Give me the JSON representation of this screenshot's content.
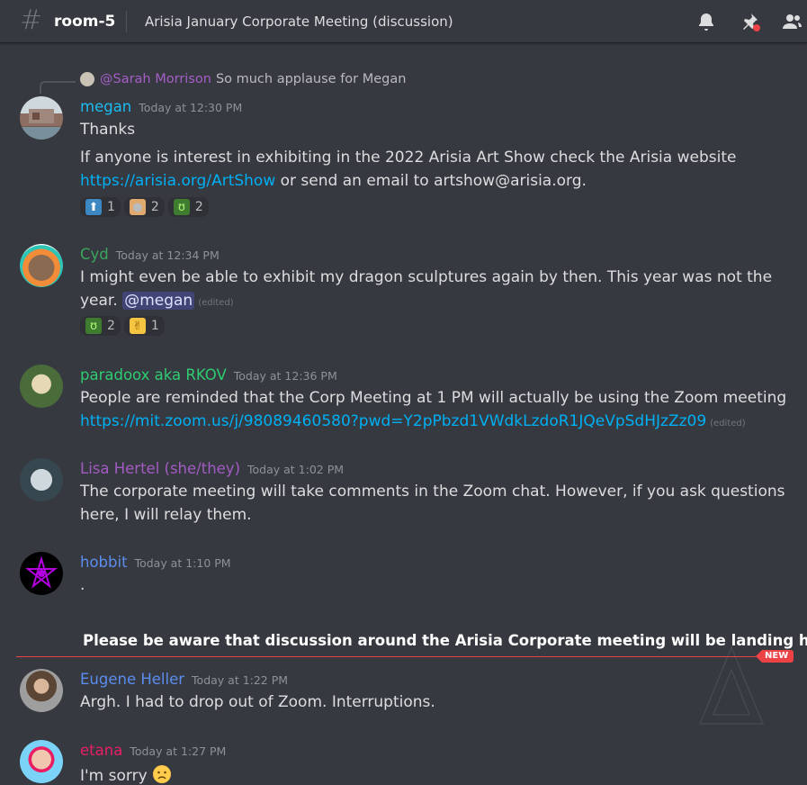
{
  "header": {
    "channel": "room-5",
    "topic": "Arisia January Corporate Meeting (discussion)",
    "icons": [
      "bell-icon",
      "pin-icon",
      "members-icon"
    ]
  },
  "reply": {
    "author": "@Sarah Morrison",
    "text": "So much applause for Megan"
  },
  "messages": [
    {
      "author": "megan",
      "color": "#1abcf0",
      "timestamp": "Today at 12:30 PM",
      "lines": [
        "Thanks",
        "If anyone is interest in exhibiting in the 2022 Arisia Art Show check the Arisia website"
      ],
      "link": "https://arisia.org/ArtShow",
      "after_link": " or send an email to artshow@arisia.org.",
      "reactions": [
        {
          "emoji": "⬆",
          "count": "1"
        },
        {
          "emoji": "🎨",
          "count": "2"
        },
        {
          "emoji": "🐉",
          "count": "2"
        }
      ]
    },
    {
      "author": "Cyd",
      "color": "#3ba55d",
      "timestamp": "Today at 12:34 PM",
      "lines": [
        "I might even be able to exhibit my dragon sculptures again by then.  This year was not the",
        "year."
      ],
      "mention": "@megan",
      "edited": "(edited)",
      "reactions": [
        {
          "emoji": "🐉",
          "count": "2"
        },
        {
          "emoji": "🤘",
          "count": "1"
        }
      ]
    },
    {
      "author": "paradoox aka RKOV",
      "color": "#2ecc71",
      "timestamp": "Today at 12:36 PM",
      "lines": [
        "People are reminded that the Corp Meeting at 1 PM will actually be using the Zoom meeting"
      ],
      "link": "https://mit.zoom.us/j/98089460580?pwd=Y2pPbzd1VWdkLzdoR1JQeVpSdHJzZz09",
      "edited": "(edited)"
    },
    {
      "author": "Lisa Hertel (she/they)",
      "color": "#a35bc4",
      "timestamp": "Today at 1:02 PM",
      "lines": [
        "The corporate meeting will take comments in the Zoom chat. However, if you ask questions",
        "here, I will relay them."
      ]
    },
    {
      "author": "hobbit",
      "color": "#5b8def",
      "timestamp": "Today at 1:10 PM",
      "lines": [
        "."
      ]
    },
    {
      "author": "Eugene Heller",
      "color": "#5b8def",
      "timestamp": "Today at 1:22 PM",
      "lines": [
        "Argh. I had to drop out of Zoom. Interruptions."
      ]
    },
    {
      "author": "etana",
      "color": "#e91e63",
      "timestamp": "Today at 1:27 PM",
      "lines": [
        "I'm sorry"
      ]
    }
  ],
  "announcement": "Please be aware that discussion around the Arisia Corporate meeting will be landing here.",
  "new_badge": "NEW"
}
